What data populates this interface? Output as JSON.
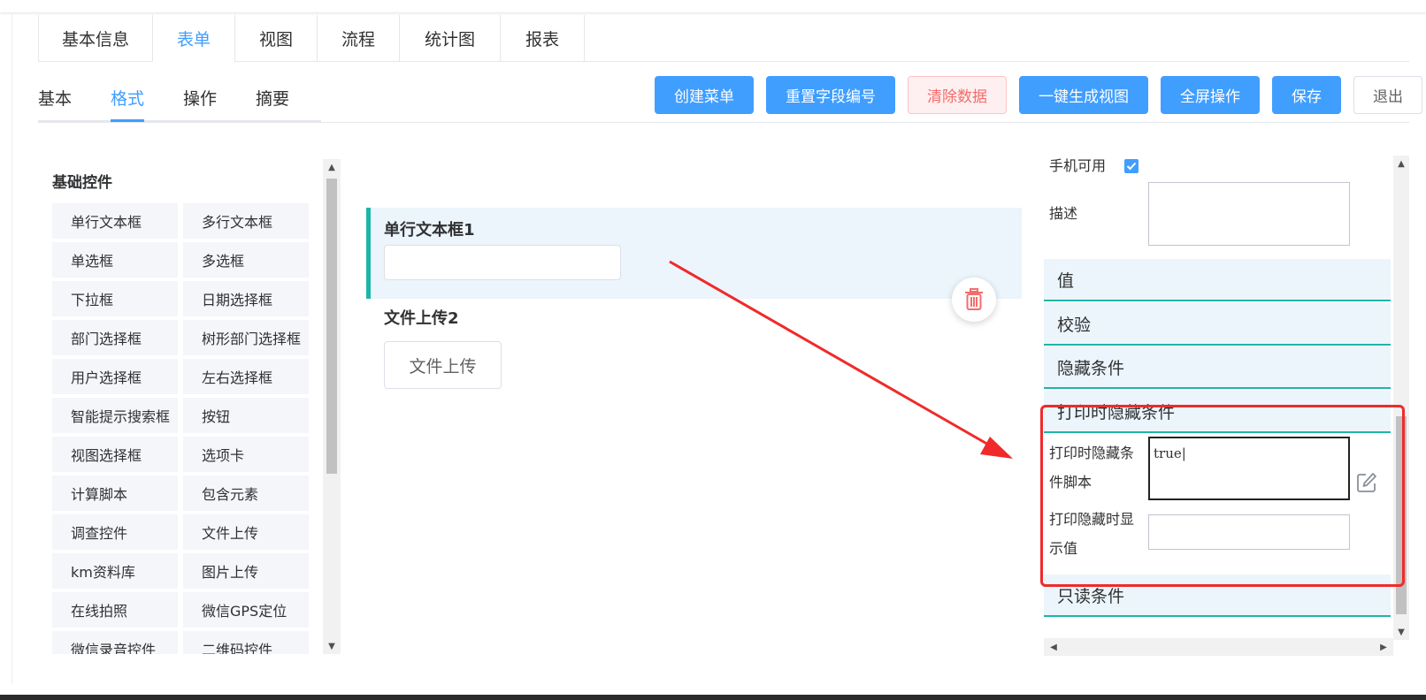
{
  "top_tabs": [
    {
      "label": "基本信息"
    },
    {
      "label": "表单"
    },
    {
      "label": "视图"
    },
    {
      "label": "流程"
    },
    {
      "label": "统计图"
    },
    {
      "label": "报表"
    }
  ],
  "sub_tabs": [
    {
      "label": "基本"
    },
    {
      "label": "格式"
    },
    {
      "label": "操作"
    },
    {
      "label": "摘要"
    }
  ],
  "actions": {
    "create_menu": "创建菜单",
    "reset_field_no": "重置字段编号",
    "clear_data": "清除数据",
    "gen_view": "一键生成视图",
    "fullscreen": "全屏操作",
    "save": "保存",
    "exit": "退出"
  },
  "palette": {
    "title": "基础控件",
    "items": [
      "单行文本框",
      "多行文本框",
      "单选框",
      "多选框",
      "下拉框",
      "日期选择框",
      "部门选择框",
      "树形部门选择框",
      "用户选择框",
      "左右选择框",
      "智能提示搜索框",
      "按钮",
      "视图选择框",
      "选项卡",
      "计算脚本",
      "包含元素",
      "调查控件",
      "文件上传",
      "km资料库",
      "图片上传",
      "在线拍照",
      "微信GPS定位",
      "微信录音控件",
      "二维码控件"
    ]
  },
  "canvas": {
    "field1_label": "单行文本框1",
    "field2_label": "文件上传2",
    "upload_button": "文件上传"
  },
  "props": {
    "mobile_label": "手机可用",
    "mobile_checked": true,
    "desc_label": "描述",
    "sections": {
      "value": "值",
      "validate": "校验",
      "hide": "隐藏条件",
      "print_hide": "打印时隐藏条件",
      "readonly": "只读条件"
    },
    "print_hide_script_label_1": "打印时隐藏条",
    "print_hide_script_label_2": "件脚本",
    "print_hide_script_value": "true",
    "print_hide_display_label_1": "打印隐藏时显",
    "print_hide_display_label_2": "示值"
  },
  "colors": {
    "primary": "#409eff",
    "teal": "#1fb5a8",
    "annotation_red": "#f02a2a",
    "danger": "#f56c6c"
  }
}
